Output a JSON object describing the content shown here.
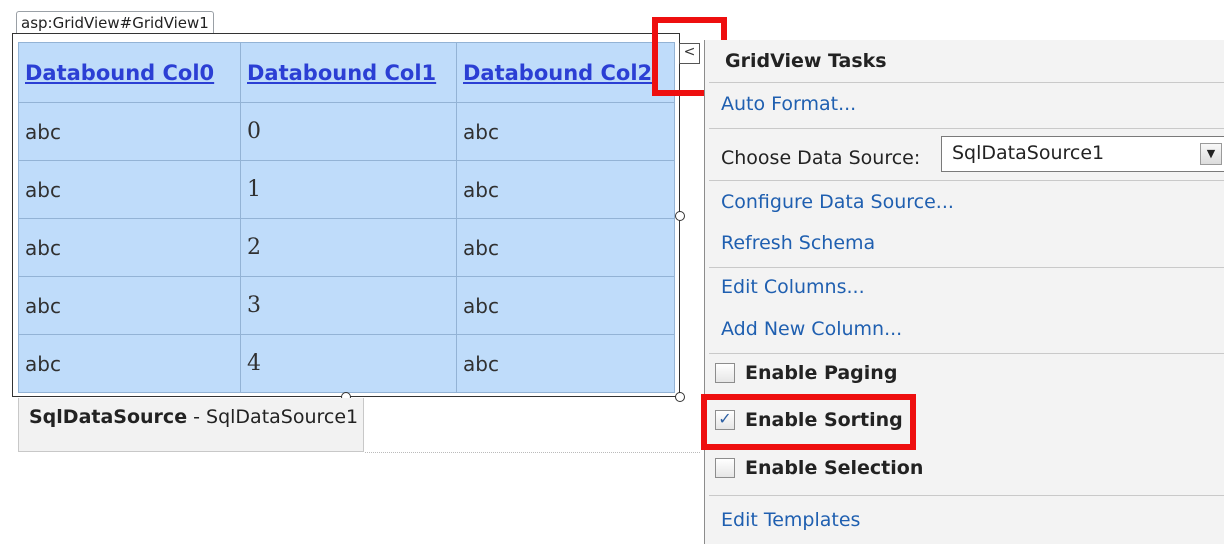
{
  "grid": {
    "tag": "asp:GridView#GridView1",
    "columns": [
      "Databound Col0",
      "Databound Col1",
      "Databound Col2"
    ],
    "rows": [
      [
        "abc",
        "0",
        "abc"
      ],
      [
        "abc",
        "1",
        "abc"
      ],
      [
        "abc",
        "2",
        "abc"
      ],
      [
        "abc",
        "3",
        "abc"
      ],
      [
        "abc",
        "4",
        "abc"
      ]
    ]
  },
  "datasource_tab": {
    "type": "SqlDataSource",
    "separator": " - ",
    "name": "SqlDataSource1"
  },
  "smart_tag": {
    "glyph": "<"
  },
  "tasks": {
    "title": "GridView Tasks",
    "auto_format": "Auto Format...",
    "choose_ds_label": "Choose Data Source:",
    "choose_ds_value": "SqlDataSource1",
    "configure_ds": "Configure Data Source...",
    "refresh_schema": "Refresh Schema",
    "edit_columns": "Edit Columns...",
    "add_column": "Add New Column...",
    "enable_paging": "Enable Paging",
    "enable_sorting": "Enable Sorting",
    "enable_selection": "Enable Selection",
    "edit_templates": "Edit Templates",
    "paging_checked": false,
    "sorting_checked": true,
    "selection_checked": false
  },
  "colors": {
    "grid_bg": "#bfdcfa",
    "header_text": "#2b3fd4",
    "link": "#1f5fb0",
    "highlight": "#ee0f0f"
  },
  "icons": {
    "dropdown": "triangle-down-icon",
    "smart_tag": "chevron-left-icon",
    "check": "checkmark-icon"
  }
}
